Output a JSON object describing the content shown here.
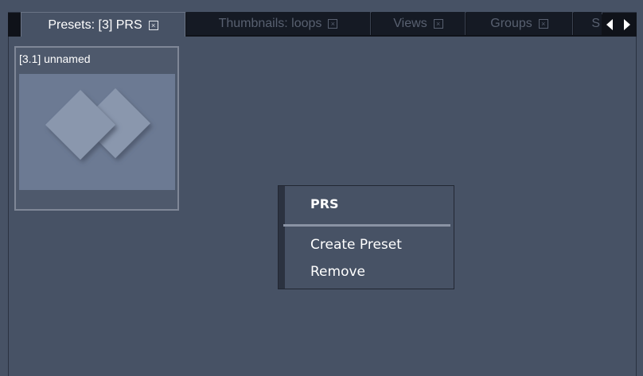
{
  "tabs": [
    {
      "label": "Presets: [3] PRS",
      "active": true
    },
    {
      "label": "Thumbnails: loops",
      "active": false
    },
    {
      "label": "Views",
      "active": false
    },
    {
      "label": "Groups",
      "active": false
    },
    {
      "label": "S",
      "active": false
    }
  ],
  "thumbnail": {
    "label": "[3.1] unnamed",
    "icon": "diamond-preset-icon"
  },
  "context_menu": {
    "title": "PRS",
    "items": [
      "Create Preset",
      "Remove"
    ]
  },
  "colors": {
    "background": "#475265",
    "tabbar": "#0f1219",
    "thumbnail_image": "#6c7a93"
  }
}
